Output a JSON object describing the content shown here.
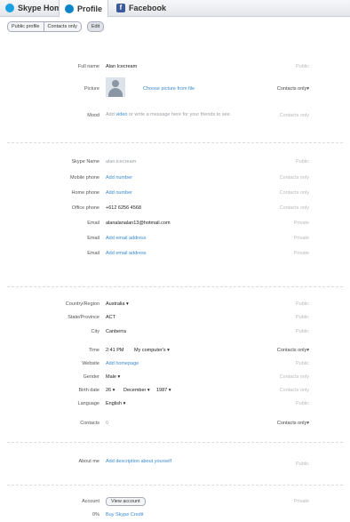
{
  "tabs": [
    {
      "label": "Skype Home"
    },
    {
      "label": "Profile"
    },
    {
      "label": "Facebook"
    }
  ],
  "view_toggle": {
    "public": "Public profile",
    "contacts": "Contacts only",
    "edit": "Edit"
  },
  "fullname": {
    "label": "Full name",
    "value": "Alan Icecream",
    "vis": "Public"
  },
  "picture": {
    "label": "Picture",
    "link": "Choose picture from file",
    "vis": "Contacts only"
  },
  "mood": {
    "label": "Mood",
    "pre": "Add ",
    "link": "video",
    "post": " or write a message here for your friends to see.",
    "vis": "Contacts only"
  },
  "skype_name": {
    "label": "Skype Name",
    "value": "alan.icecream",
    "vis": "Public"
  },
  "mobile": {
    "label": "Mobile phone",
    "value": "Add number",
    "vis": "Contacts only"
  },
  "home": {
    "label": "Home phone",
    "value": "Add number",
    "vis": "Contacts only"
  },
  "office": {
    "label": "Office phone",
    "value": "+612 6256 4568",
    "vis": "Contacts only"
  },
  "email1": {
    "label": "Email",
    "value": "alanalanalan13@hotmail.com",
    "vis": "Private"
  },
  "email2": {
    "label": "Email",
    "value": "Add email address",
    "vis": "Private"
  },
  "email3": {
    "label": "Email",
    "value": "Add email address",
    "vis": "Private"
  },
  "country": {
    "label": "Country/Region",
    "value": "Australia",
    "vis": "Public"
  },
  "state": {
    "label": "State/Province",
    "value": "ACT",
    "vis": "Public"
  },
  "city": {
    "label": "City",
    "value": "Canberra",
    "vis": "Public"
  },
  "time": {
    "label": "Time",
    "value": "2:41 PM",
    "tz": "My computer's",
    "vis": "Contacts only"
  },
  "website": {
    "label": "Website",
    "value": "Add homepage",
    "vis": "Public"
  },
  "gender": {
    "label": "Gender",
    "value": "Male",
    "vis": "Contacts only"
  },
  "birth": {
    "label": "Birth date",
    "day": "26",
    "month": "December",
    "year": "1987",
    "vis": "Contacts only"
  },
  "language": {
    "label": "Language",
    "value": "English",
    "vis": "Public"
  },
  "contacts": {
    "label": "Contacts",
    "value": "0",
    "vis": "Contacts only"
  },
  "about": {
    "label": "About me",
    "value": "Add description about yourself",
    "vis": "Public"
  },
  "account": {
    "label": "Account",
    "button": "View account",
    "vis": "Private"
  },
  "credit": {
    "label": "0%",
    "value": "Buy Skype Credit"
  },
  "dropdown_arrow": "▾"
}
